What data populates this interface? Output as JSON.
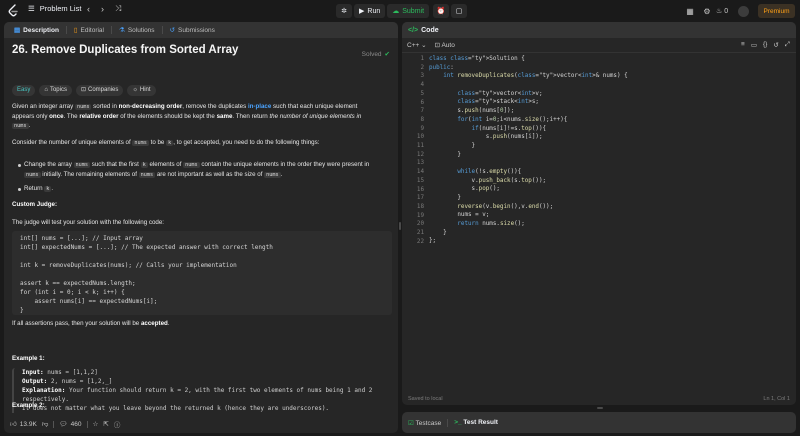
{
  "topbar": {
    "problem_list_label": "Problem List",
    "run_label": "Run",
    "submit_label": "Submit",
    "streak_count": "0",
    "premium_label": "Premium"
  },
  "left_tabs": [
    {
      "label": "Description",
      "icon": "document-icon"
    },
    {
      "label": "Editorial",
      "icon": "book-icon"
    },
    {
      "label": "Solutions",
      "icon": "flask-icon"
    },
    {
      "label": "Submissions",
      "icon": "history-icon"
    }
  ],
  "problem": {
    "title": "26. Remove Duplicates from Sorted Array",
    "status": "Solved",
    "difficulty": "Easy",
    "pills": [
      "Topics",
      "Companies",
      "Hint"
    ],
    "p1_a": "Given an integer array ",
    "p1_nums": "nums",
    "p1_b": " sorted in ",
    "p1_c": "non-decreasing order",
    "p1_d": ", remove the duplicates ",
    "p1_e": "in-place",
    "p1_f": " such that each unique element",
    "p1_g": "appears only ",
    "p1_h": "once",
    "p1_i": ". The ",
    "p1_j": "relative order",
    "p1_k": " of the elements should be kept the ",
    "p1_l": "same",
    "p1_m": ". Then return ",
    "p1_n": "the number of unique elements in",
    "p1_o": "nums",
    "p1_p": ".",
    "p2_a": "Consider the number of unique elements of ",
    "p2_b": "nums",
    "p2_c": " to be ",
    "p2_d": "k",
    "p2_e": ", to get accepted, you need to do the following things:",
    "b1_a": "Change the array ",
    "b1_b": "nums",
    "b1_c": " such that the first ",
    "b1_d": "k",
    "b1_e": " elements of ",
    "b1_f": "nums",
    "b1_g": " contain the unique elements in the order they were present in",
    "b1_h": "nums",
    "b1_i": " initially. The remaining elements of ",
    "b1_j": "nums",
    "b1_k": " are not important as well as the size of ",
    "b1_l": "nums",
    "b1_m": ".",
    "b2_a": "Return ",
    "b2_b": "k",
    "b2_c": ".",
    "judge_title": "Custom Judge:",
    "judge_text": "The judge will test your solution with the following code:",
    "judge_code": "int[] nums = [...]; // Input array\nint[] expectedNums = [...]; // The expected answer with correct length\n\nint k = removeDuplicates(nums); // Calls your implementation\n\nassert k == expectedNums.length;\nfor (int i = 0; i < k; i++) {\n    assert nums[i] == expectedNums[i];\n}",
    "pass_a": "If all assertions pass, then your solution will be ",
    "pass_b": "accepted",
    "pass_c": ".",
    "ex1_title": "Example 1:",
    "ex1_input_label": "Input:",
    "ex1_input": " nums = [1,1,2]",
    "ex1_output_label": "Output:",
    "ex1_output": " 2, nums = [1,2,_]",
    "ex1_expl_label": "Explanation:",
    "ex1_expl": " Your function should return k = 2, with the first two elements of nums being 1 and 2\nrespectively.\nIt does not matter what you leave beyond the returned k (hence they are underscores).",
    "ex2_title": "Example 2:"
  },
  "stats": {
    "likes": "13.9K",
    "comments": "460"
  },
  "code_panel": {
    "tab_label": "Code",
    "language": "C++",
    "mode": "Auto",
    "save_status": "Saved to local",
    "cursor": "Ln 1, Col 1",
    "lines": [
      "class Solution {",
      "public:",
      "    int removeDuplicates(vector<int>& nums) {",
      "",
      "        vector<int>v;",
      "        stack<int>s;",
      "        s.push(nums[0]);",
      "        for(int i=0;i<nums.size();i++){",
      "            if(nums[i]!=s.top()){",
      "                s.push(nums[i]);",
      "            }",
      "        }",
      "",
      "        while(!s.empty()){",
      "            v.push_back(s.top());",
      "            s.pop();",
      "        }",
      "        reverse(v.begin(),v.end());",
      "        nums = v;",
      "        return nums.size();",
      "    }",
      "};"
    ]
  },
  "test_panel": {
    "testcase_label": "Testcase",
    "result_label": "Test Result"
  }
}
